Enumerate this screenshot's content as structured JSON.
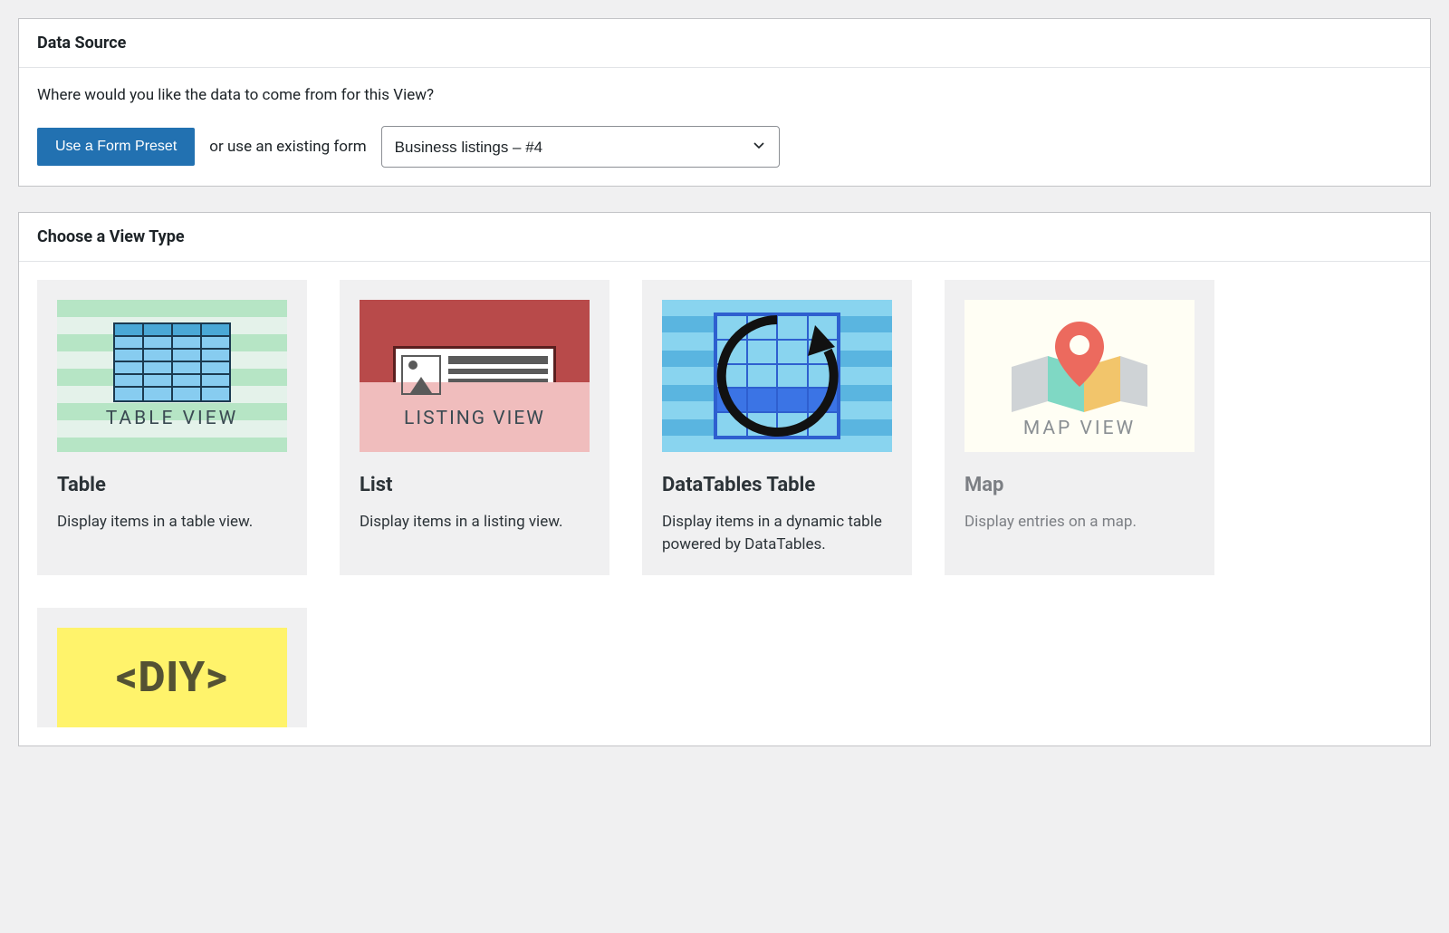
{
  "dataSource": {
    "title": "Data Source",
    "prompt": "Where would you like the data to come from for this View?",
    "presetButton": "Use a Form Preset",
    "orText": "or use an existing form",
    "selected": "Business listings – #4"
  },
  "viewType": {
    "title": "Choose a View Type",
    "cards": [
      {
        "title": "Table",
        "desc": "Display items in a table view.",
        "caption": "TABLE VIEW"
      },
      {
        "title": "List",
        "desc": "Display items in a listing view.",
        "caption": "LISTING VIEW"
      },
      {
        "title": "DataTables Table",
        "desc": "Display items in a dynamic table powered by DataTables."
      },
      {
        "title": "Map",
        "desc": "Display entries on a map.",
        "caption": "MAP VIEW"
      },
      {
        "title": "DIY",
        "caption": "<DIY>"
      }
    ]
  }
}
